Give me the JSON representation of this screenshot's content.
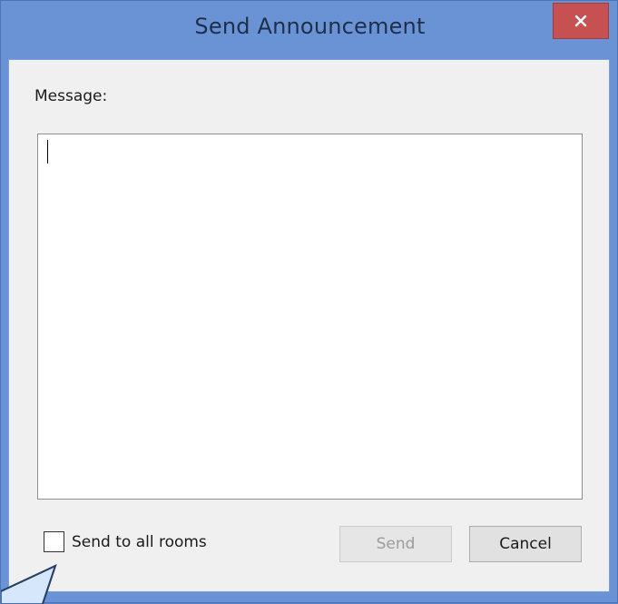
{
  "window": {
    "title": "Send Announcement",
    "close_symbol": "×",
    "colors": {
      "frame": "#6a93d6",
      "close_button": "#c75050",
      "client": "#f0f0f0"
    }
  },
  "form": {
    "message_label": "Message:",
    "message_value": "",
    "send_to_all_label": "Send to all rooms",
    "send_to_all_checked": false
  },
  "buttons": {
    "send_label": "Send",
    "send_enabled": false,
    "cancel_label": "Cancel"
  },
  "icons": {
    "close": "close-icon",
    "callout": "callout-pointer"
  }
}
